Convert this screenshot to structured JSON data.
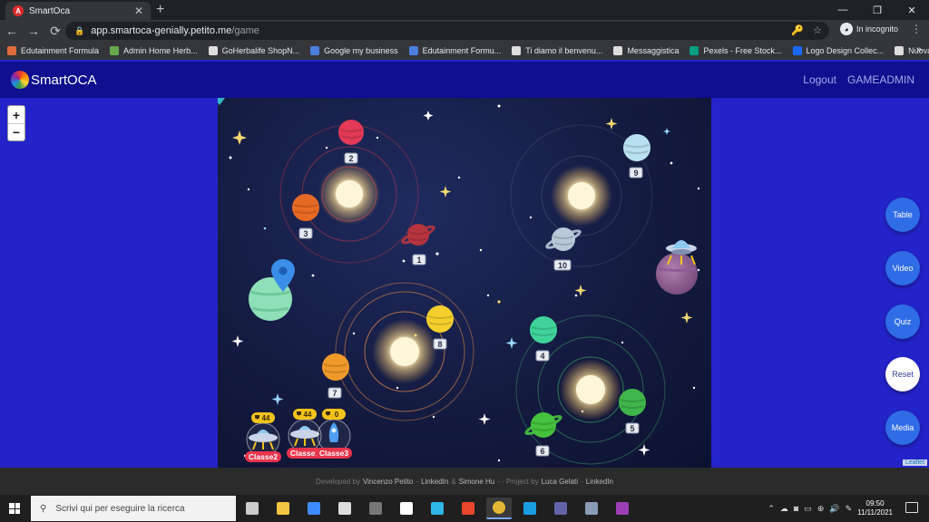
{
  "browser": {
    "tab_title": "SmartOca",
    "tab_favicon_letter": "A",
    "close_glyph": "✕",
    "new_tab_glyph": "+",
    "window_controls": [
      "—",
      "❐",
      "✕"
    ],
    "nav": {
      "back": "←",
      "forward": "→",
      "reload": "⟳"
    },
    "url_host": "app.smartoca-genially.petito.me",
    "url_path": "/game",
    "omni_icons": [
      "🔑",
      "☆"
    ],
    "incognito_label": "In incognito",
    "menu_glyph": "⋮",
    "bookmarks": [
      {
        "label": "Edutainment Formula",
        "icon": "pinwheel-icon",
        "color": "#e06c3c"
      },
      {
        "label": "Admin Home Herb...",
        "icon": "download-icon",
        "color": "#6aa84f"
      },
      {
        "label": "GoHerbalife ShopN...",
        "icon": "globe-icon",
        "color": "#dddddd"
      },
      {
        "label": "Google my business",
        "icon": "people-icon",
        "color": "#4a7fe0"
      },
      {
        "label": "Edutainment Formu...",
        "icon": "people-icon",
        "color": "#4a7fe0"
      },
      {
        "label": "Ti diamo il benvenu...",
        "icon": "store-icon",
        "color": "#dddddd"
      },
      {
        "label": "Messaggistica",
        "icon": "globe-icon",
        "color": "#dddddd"
      },
      {
        "label": "Pexels - Free Stock...",
        "icon": "pexels-icon",
        "color": "#05a081"
      },
      {
        "label": "Logo Design Collec...",
        "icon": "behance-icon",
        "color": "#1769ff"
      },
      {
        "label": "Nuova scheda",
        "icon": "globe-icon",
        "color": "#dddddd"
      }
    ],
    "bookmarks_more": "»"
  },
  "app": {
    "logo_text": "SmartOCA",
    "nav": {
      "logout": "Logout",
      "user": "GAMEADMIN"
    },
    "zoom": {
      "in": "+",
      "out": "−"
    },
    "side_buttons": [
      {
        "key": "table",
        "label": "Table",
        "variant": "blue"
      },
      {
        "key": "video",
        "label": "Video",
        "variant": "blue"
      },
      {
        "key": "quiz",
        "label": "Quiz",
        "variant": "blue"
      },
      {
        "key": "reset",
        "label": "Reset",
        "variant": "light"
      },
      {
        "key": "media",
        "label": "Media",
        "variant": "blue"
      }
    ],
    "leaflet_attribution": "Leaflet",
    "colors": {
      "page_bg": "#2323c9",
      "header_bg": "#0f0f8f",
      "board_bg": "#141b40",
      "button_blue": "#2f6de6",
      "team_badge": "#e8354d",
      "trophy_badge": "#f3c21b"
    }
  },
  "board": {
    "planets": [
      {
        "id": "planet-1",
        "label": "1",
        "color": "#b7343f",
        "ringed": true
      },
      {
        "id": "planet-2",
        "label": "2",
        "color": "#e23a57",
        "ringed": false
      },
      {
        "id": "planet-3",
        "label": "3",
        "color": "#e76a24",
        "ringed": false
      },
      {
        "id": "planet-4",
        "label": "4",
        "color": "#3fd39a",
        "ringed": false
      },
      {
        "id": "planet-5",
        "label": "5",
        "color": "#3fb54a",
        "ringed": false
      },
      {
        "id": "planet-6",
        "label": "6",
        "color": "#46c23e",
        "ringed": true
      },
      {
        "id": "planet-7",
        "label": "7",
        "color": "#f09a2a",
        "ringed": false
      },
      {
        "id": "planet-8",
        "label": "8",
        "color": "#f4cf2c",
        "ringed": false
      },
      {
        "id": "planet-9",
        "label": "9",
        "color": "#b9e0f0",
        "ringed": false
      },
      {
        "id": "planet-10",
        "label": "10",
        "color": "#b8c8d8",
        "ringed": true
      }
    ],
    "teams": [
      {
        "name": "Classe2",
        "score": "44",
        "avatar": "ufo-icon"
      },
      {
        "name": "Classe1",
        "score": "44",
        "avatar": "ufo-icon"
      },
      {
        "name": "Classe3",
        "score": "0",
        "avatar": "rocket-icon"
      }
    ],
    "start_marker": "map-pin-icon",
    "goal_marker": "ufo-icon"
  },
  "footer": {
    "developed_by": "Developed by",
    "dev_name": "Vincenzo Petito",
    "sep1": "-",
    "linkedin1": "LinkedIn",
    "amp": "&",
    "dev2": "Simone Hu",
    "sep2": "- - Project by",
    "project_by": "Luca Gelati",
    "sep3": "-",
    "linkedin2": "LinkedIn"
  },
  "taskbar": {
    "search_placeholder": "Scrivi qui per eseguire la ricerca",
    "apps": [
      {
        "name": "task-view-icon",
        "color": "#cccccc"
      },
      {
        "name": "file-explorer-icon",
        "color": "#f4c542"
      },
      {
        "name": "dropbox-icon",
        "color": "#3d8bfd"
      },
      {
        "name": "store-icon",
        "color": "#dddddd"
      },
      {
        "name": "mail-icon",
        "color": "#777777"
      },
      {
        "name": "amazon-icon",
        "color": "#ffffff"
      },
      {
        "name": "edge-icon",
        "color": "#2fb5e8"
      },
      {
        "name": "office-icon",
        "color": "#e9462b"
      },
      {
        "name": "chrome-icon",
        "color": "#e4b832"
      },
      {
        "name": "skype-icon",
        "color": "#1b9de2"
      },
      {
        "name": "teams-icon",
        "color": "#6264a7"
      },
      {
        "name": "notes-icon",
        "color": "#8a9bb8"
      },
      {
        "name": "winrar-icon",
        "color": "#9b3fb5"
      }
    ],
    "tray_glyphs": [
      "⌃",
      "☁",
      "◙",
      "▭",
      "⊕",
      "🔊",
      "✎"
    ],
    "time": "09:50",
    "date": "11/11/2021"
  }
}
